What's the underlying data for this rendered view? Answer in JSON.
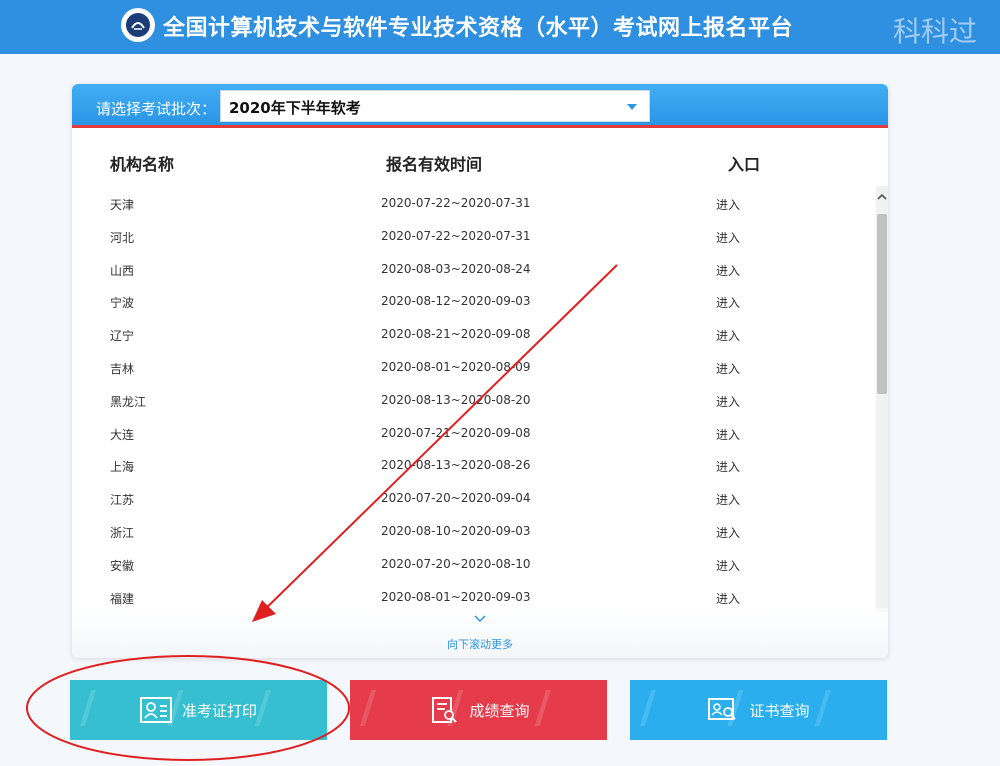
{
  "header": {
    "title": "全国计算机技术与软件专业技术资格（水平）考试网上报名平台",
    "watermark": "科科过"
  },
  "batch": {
    "label": "请选择考试批次：",
    "selected": "2020年下半年软考"
  },
  "table": {
    "headers": [
      "机构名称",
      "报名有效时间",
      "入口"
    ],
    "rows": [
      {
        "name": "天津",
        "period": "2020-07-22~2020-07-31",
        "entry": "进入"
      },
      {
        "name": "河北",
        "period": "2020-07-22~2020-07-31",
        "entry": "进入"
      },
      {
        "name": "山西",
        "period": "2020-08-03~2020-08-24",
        "entry": "进入"
      },
      {
        "name": "宁波",
        "period": "2020-08-12~2020-09-03",
        "entry": "进入"
      },
      {
        "name": "辽宁",
        "period": "2020-08-21~2020-09-08",
        "entry": "进入"
      },
      {
        "name": "吉林",
        "period": "2020-08-01~2020-08-09",
        "entry": "进入"
      },
      {
        "name": "黑龙江",
        "period": "2020-08-13~2020-08-20",
        "entry": "进入"
      },
      {
        "name": "大连",
        "period": "2020-07-21~2020-09-08",
        "entry": "进入"
      },
      {
        "name": "上海",
        "period": "2020-08-13~2020-08-26",
        "entry": "进入"
      },
      {
        "name": "江苏",
        "period": "2020-07-20~2020-09-04",
        "entry": "进入"
      },
      {
        "name": "浙江",
        "period": "2020-08-10~2020-09-03",
        "entry": "进入"
      },
      {
        "name": "安徽",
        "period": "2020-07-20~2020-08-10",
        "entry": "进入"
      },
      {
        "name": "福建",
        "period": "2020-08-01~2020-09-03",
        "entry": "进入"
      }
    ],
    "more_text": "向下滚动更多"
  },
  "buttons": {
    "ticket": "准考证打印",
    "score": "成绩查询",
    "cert": "证书查询"
  },
  "icons": {
    "logo": "logo-icon",
    "caret": "caret-down-icon",
    "scroll_up": "chevron-up-icon",
    "more": "chevron-down-icon",
    "ticket": "id-card-icon",
    "score": "document-search-icon",
    "cert": "certificate-search-icon"
  },
  "colors": {
    "header": "#2f8fe0",
    "panel_top": "#2b95e6",
    "accent_red": "#e33a3a",
    "btn_ticket": "#36bfd1",
    "btn_score": "#e63b4a",
    "btn_cert": "#2aaeee",
    "annotation": "#e02020"
  }
}
